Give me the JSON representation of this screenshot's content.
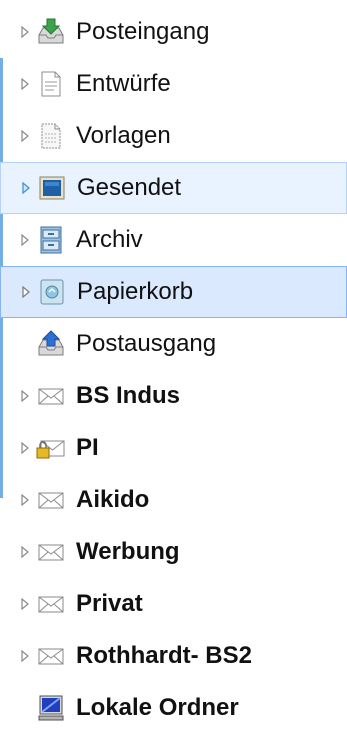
{
  "folders": [
    {
      "label": "Posteingang"
    },
    {
      "label": "Entwürfe"
    },
    {
      "label": "Vorlagen"
    },
    {
      "label": "Gesendet"
    },
    {
      "label": "Archiv"
    },
    {
      "label": "Papierkorb"
    },
    {
      "label": "Postausgang"
    },
    {
      "label": "BS Indus"
    },
    {
      "label": "PI"
    },
    {
      "label": "Aikido"
    },
    {
      "label": "Werbung"
    },
    {
      "label": "Privat"
    },
    {
      "label": "Rothhardt- BS2"
    },
    {
      "label": "Lokale Ordner"
    }
  ],
  "colors": {
    "selection_bg": "#dbe9ff",
    "selection_border": "#86b5f7",
    "accent": "#5aa0e0"
  }
}
